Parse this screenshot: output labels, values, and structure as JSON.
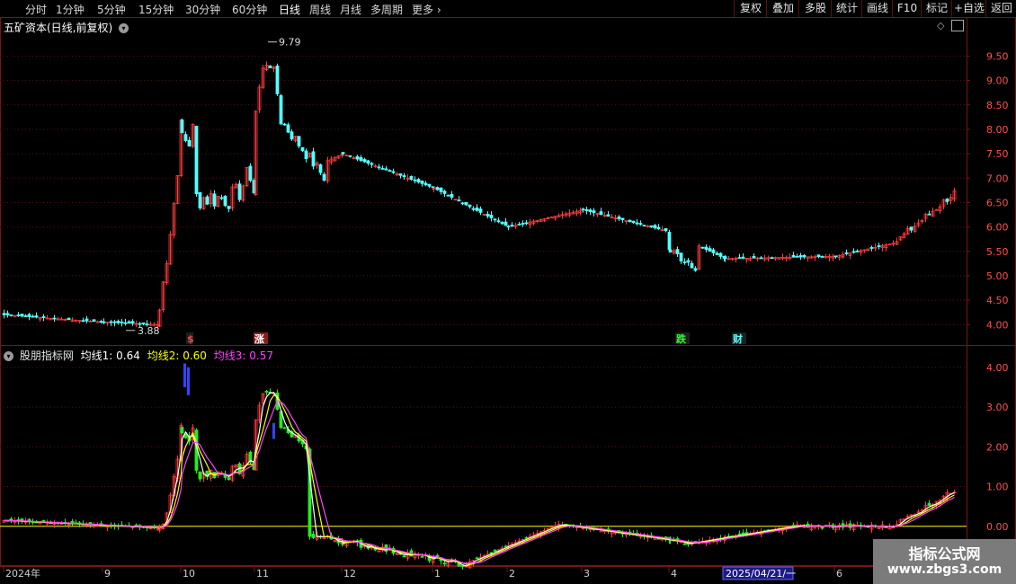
{
  "toolbar": {
    "periods": [
      "分时",
      "1分钟",
      "5分钟",
      "15分钟",
      "30分钟",
      "60分钟",
      "日线",
      "周线",
      "月线",
      "多周期",
      "更多"
    ],
    "active_period": "日线",
    "buttons": [
      "复权",
      "叠加",
      "多股",
      "统计",
      "画线",
      "F10",
      "标记",
      "+自选",
      "返回"
    ]
  },
  "colors": {
    "up": "#ff3b3b",
    "down": "#54ffff",
    "border": "#7a1414",
    "grid": "#5a0c0c",
    "ma1": "#ffffff",
    "ma2": "#ffff00",
    "ma3": "#ff44ff",
    "zero": "#ffff00"
  },
  "main_panel": {
    "title": "五矿资本(日线,前复权)",
    "high_label": "9.79",
    "low_label": "3.88",
    "y_ticks": [
      "9.50",
      "9.00",
      "8.50",
      "8.00",
      "7.50",
      "7.00",
      "6.50",
      "6.00",
      "5.50",
      "5.00",
      "4.50",
      "4.00"
    ],
    "markers": [
      {
        "text": "$",
        "color": "#ff4444"
      },
      {
        "text": "涨",
        "color": "#ffffff"
      },
      {
        "text": "跌",
        "color": "#33ff33"
      },
      {
        "text": "财",
        "color": "#54ffff"
      }
    ]
  },
  "indicator_panel": {
    "name": "股朋指标网",
    "ma1_text": "均线1: 0.64",
    "ma2_text": "均线2: 0.60",
    "ma3_text": "均线3: 0.57",
    "y_ticks": [
      "4.00",
      "3.00",
      "2.00",
      "1.00",
      "0.00"
    ]
  },
  "x_axis": {
    "labels": [
      "2024年",
      "9",
      "10",
      "11",
      "12",
      "1",
      "2",
      "3",
      "4",
      "2025/04/21/一",
      "6"
    ]
  },
  "watermark": {
    "line1": "指标公式网",
    "line2": "www.zbgs3.com"
  },
  "chart_data": [
    {
      "type": "candlestick",
      "title": "五矿资本(日线,前复权)",
      "ylim": [
        3.6,
        9.95
      ],
      "x_labels": [
        "2024年",
        "9",
        "10",
        "11",
        "12",
        "1",
        "2",
        "3",
        "4",
        "2025/04/21/一",
        "6"
      ],
      "period_closes": [
        {
          "period": "2024-08",
          "start": 4.2,
          "end": 4.05
        },
        {
          "period": "2024-09",
          "start": 4.05,
          "end": 4.0
        },
        {
          "period": "2024-09-late",
          "start": 4.0,
          "end": 6.6
        },
        {
          "period": "2024-10",
          "start": 6.6,
          "end": 6.7
        },
        {
          "period": "2024-11",
          "start": 6.7,
          "end": 7.5
        },
        {
          "period": "2024-12",
          "start": 7.5,
          "end": 6.8
        },
        {
          "period": "2025-01",
          "start": 6.8,
          "end": 6.0
        },
        {
          "period": "2025-02",
          "start": 6.0,
          "end": 6.35
        },
        {
          "period": "2025-03",
          "start": 6.35,
          "end": 5.9
        },
        {
          "period": "2025-04",
          "start": 5.9,
          "end": 5.35
        },
        {
          "period": "2025-05",
          "start": 5.35,
          "end": 5.4
        },
        {
          "period": "2025-06",
          "start": 5.4,
          "end": 5.7
        },
        {
          "period": "2025-07",
          "start": 5.7,
          "end": 6.5
        }
      ],
      "high": 9.79,
      "low": 3.88
    },
    {
      "type": "line",
      "title": "股朋指标网",
      "ylim": [
        -1.0,
        4.2
      ],
      "series": [
        {
          "name": "均线1",
          "last": 0.64
        },
        {
          "name": "均线2",
          "last": 0.6
        },
        {
          "name": "均线3",
          "last": 0.57
        }
      ],
      "x": [
        "2024-08",
        "2024-09",
        "2024-09-late",
        "2024-10",
        "2024-10-mid",
        "2024-11",
        "2024-11-mid",
        "2024-12",
        "2025-01",
        "2025-01-mid",
        "2025-02",
        "2025-03",
        "2025-04",
        "2025-04-mid",
        "2025-05",
        "2025-06",
        "2025-06-late",
        "2025-07"
      ],
      "values": [
        0.15,
        0.05,
        -0.1,
        2.9,
        2.2,
        1.5,
        2.1,
        -0.2,
        -0.4,
        -0.9,
        -0.3,
        0.05,
        -0.1,
        -0.45,
        -0.4,
        0.0,
        0.1,
        0.65
      ]
    }
  ]
}
